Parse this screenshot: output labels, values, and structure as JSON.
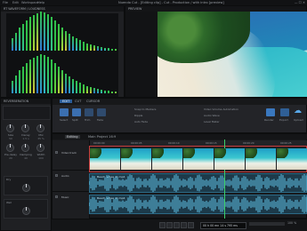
{
  "menu": {
    "items": [
      "File",
      "Edit",
      "Workspace",
      "Help"
    ]
  },
  "window_title": "Nuendo Cut - [Editing clip] - Cut - Production / with intro [preview]",
  "meters_panel": {
    "title": "RT WAVEFORM / LOUDNESS",
    "db_labels": [
      "0",
      "-6",
      "-12",
      "-18",
      "-24",
      "-30",
      "-36",
      "-42"
    ]
  },
  "preview_panel": {
    "title": "PREVIEW"
  },
  "effect_panel": {
    "title": "REVERBERATION",
    "knobs": [
      {
        "label": "Size",
        "value": "50"
      },
      {
        "label": "Decay",
        "value": "1.5 s"
      },
      {
        "label": "Mix",
        "value": "35 %"
      },
      {
        "label": "Pre-delay",
        "value": "20"
      },
      {
        "label": "Damping",
        "value": "40"
      },
      {
        "label": "Width",
        "value": "100"
      }
    ],
    "sections": [
      "Dry",
      "Wet"
    ]
  },
  "toolbar": {
    "tabs": [
      "EDIT",
      "CUT",
      "CURSOR"
    ],
    "tools": [
      {
        "label": "Select",
        "icon": "arrow-icon",
        "color": "#3b6fb0"
      },
      {
        "label": "Split",
        "icon": "scissors-icon",
        "color": "#3b6fb0"
      },
      {
        "label": "Trim",
        "icon": "trim-icon",
        "color": "#2f4b6e"
      },
      {
        "label": "Fade",
        "icon": "fade-icon",
        "color": "#2f4b6e"
      }
    ],
    "options": [
      "Snap to Markers",
      "Ripple",
      "Auto Fade"
    ],
    "right_tools": [
      "Video Volume Automation",
      "Audio Wave",
      "Level Meter",
      "Render",
      "Export"
    ],
    "cloud_label": "Upload"
  },
  "timeline": {
    "tabs": [
      "Editing",
      "Main Project 16:9"
    ],
    "ruler": [
      "00:00:00",
      "00:00:05",
      "00:00:10",
      "00:00:15",
      "00:00:20",
      "00:00:25"
    ],
    "tracks": [
      {
        "name": "Video track",
        "type": "video"
      },
      {
        "name": "Audio",
        "type": "audio-1"
      },
      {
        "name": "Music",
        "type": "audio-2"
      }
    ],
    "clip_labels": [
      "Beach & Sea 4k.mp4",
      "Beach & Sea 4k.mp4"
    ]
  },
  "transport": {
    "timecode": "00 h 00 mn 14 s 795 ms",
    "zoom": "100 %"
  },
  "colors": {
    "accent": "#2f7fc7",
    "selection": "#c83b3b",
    "meter_green": "#30c14a",
    "meter_blue": "#2f76d6"
  }
}
